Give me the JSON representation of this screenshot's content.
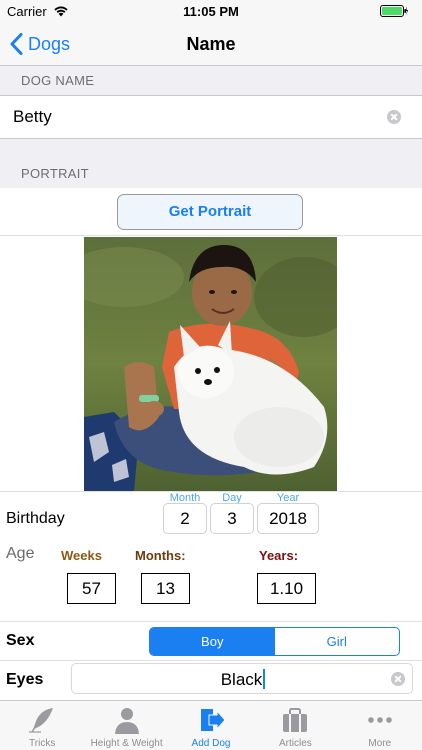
{
  "status_bar": {
    "carrier": "Carrier",
    "time": "11:05 PM"
  },
  "nav": {
    "back_label": "Dogs",
    "title": "Name"
  },
  "dog_name_section": {
    "header": "DOG NAME",
    "value": "Betty"
  },
  "portrait_section": {
    "header": "PORTRAIT",
    "button_label": "Get Portrait"
  },
  "birthday": {
    "label": "Birthday",
    "month_head": "Month",
    "day_head": "Day",
    "year_head": "Year",
    "month": "2",
    "day": "3",
    "year": "2018"
  },
  "age": {
    "label": "Age",
    "weeks_head": "Weeks",
    "months_head": "Months:",
    "years_head": "Years:",
    "weeks": "57",
    "months": "13",
    "years": "1.10"
  },
  "sex": {
    "label": "Sex",
    "options": [
      "Boy",
      "Girl"
    ],
    "selected": "Boy"
  },
  "eyes": {
    "label": "Eyes",
    "value": "Black"
  },
  "tabs": [
    {
      "label": "Tricks",
      "icon": "quill-icon",
      "active": false
    },
    {
      "label": "Height & Weight",
      "icon": "person-icon",
      "active": false
    },
    {
      "label": "Add Dog",
      "icon": "add-dog-icon",
      "active": true
    },
    {
      "label": "Articles",
      "icon": "briefcase-icon",
      "active": false
    },
    {
      "label": "More",
      "icon": "more-icon",
      "active": false
    }
  ],
  "colors": {
    "accent": "#1a7ff0",
    "weeks_head": "#8a5a14",
    "months_head": "#6b3d0f",
    "years_head": "#7a1010",
    "date_head": "#4aa8e6"
  }
}
